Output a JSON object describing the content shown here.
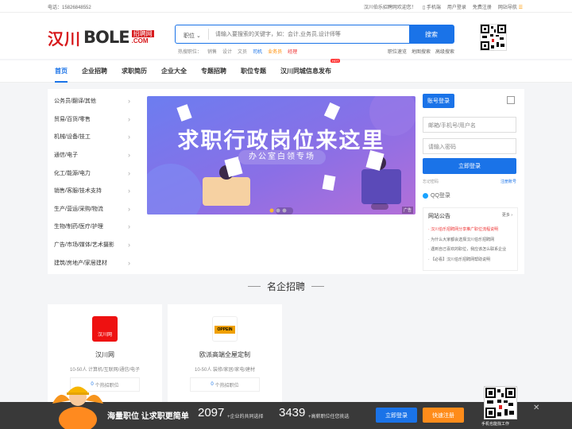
{
  "topbar": {
    "phone": "电话：15826848552",
    "welcome": "汉川伯乐招聘网欢迎您！",
    "mobile": "手机端",
    "login": "用户登录",
    "register": "免费注册",
    "sitenav": "网站导航"
  },
  "logo": {
    "cn": "汉川",
    "en": "BOLE",
    "tag1": "招聘网",
    "tag2": ".COM"
  },
  "search": {
    "type": "职位",
    "placeholder": "请输入要搜索的关键字，如：会计,业务员,设计师等",
    "button": "搜索"
  },
  "hot": {
    "label": "热搜职位：",
    "items": [
      "销售",
      "设计",
      "文员",
      "司机",
      "业务员",
      "经理"
    ]
  },
  "quick": [
    "职位速览",
    "地图搜索",
    "高级搜索"
  ],
  "nav": {
    "items": [
      "首页",
      "企业招聘",
      "求职简历",
      "企业大全",
      "专题招聘",
      "职位专题",
      "汉川同城信息发布"
    ],
    "badge": "HOT"
  },
  "categories": [
    "公务员/翻译/其他",
    "贸易/百货/零售",
    "机械/设备/技工",
    "通信/电子",
    "化工/能源/电力",
    "销售/客服/技术支持",
    "生产/营运/采购/物流",
    "生物/制药/医疗/护理",
    "广告/市场/媒体/艺术摄影",
    "建筑/房地产/家居建材"
  ],
  "banner": {
    "headline": "求职行政岗位来这里",
    "sub": "办公室白领专场",
    "ad": "广告"
  },
  "login": {
    "title": "账号登录",
    "username_placeholder": "邮箱/手机号/用户名",
    "password_placeholder": "请输入密码",
    "button": "立即登录",
    "forgot": "忘记密码",
    "register": "注册账号",
    "qq": "QQ登录"
  },
  "notice": {
    "title": "网站公告",
    "more": "更多",
    "items": [
      "汉川伯乐招聘网分享推广职位流程说明",
      "为什么大家都会选择汉川伯乐招聘网",
      "遇到自己喜欢的职位，我应该怎么联系企业",
      "【必看】汉川伯乐招聘网帮助说明"
    ]
  },
  "section": {
    "title": "名企招聘"
  },
  "companies": [
    {
      "name": "汉川网",
      "meta": "10-50人  计算机/互联网/通信/电子",
      "jobs_count": "0",
      "jobs_label": "个热招职位",
      "logo_text": "汉川网"
    },
    {
      "name": "欧派高端全屋定制",
      "meta": "10-50人  装修/家居/家电/建材",
      "jobs_count": "0",
      "jobs_label": "个热招职位",
      "logo_text": "OPPEIN"
    }
  ],
  "footer": {
    "slogan": "海量职位 让求职更简单",
    "n1": "2097",
    "l1": "+企业的共同选择",
    "n2": "3439",
    "l2": "+高薪职位任您挑选",
    "login": "立即登录",
    "register": "快速注册",
    "qr_caption": "手机也能找工作",
    "close": "✕"
  },
  "colors": {
    "primary": "#1a73e8",
    "brand_red": "#d7191c",
    "orange": "#ff8c1a"
  }
}
